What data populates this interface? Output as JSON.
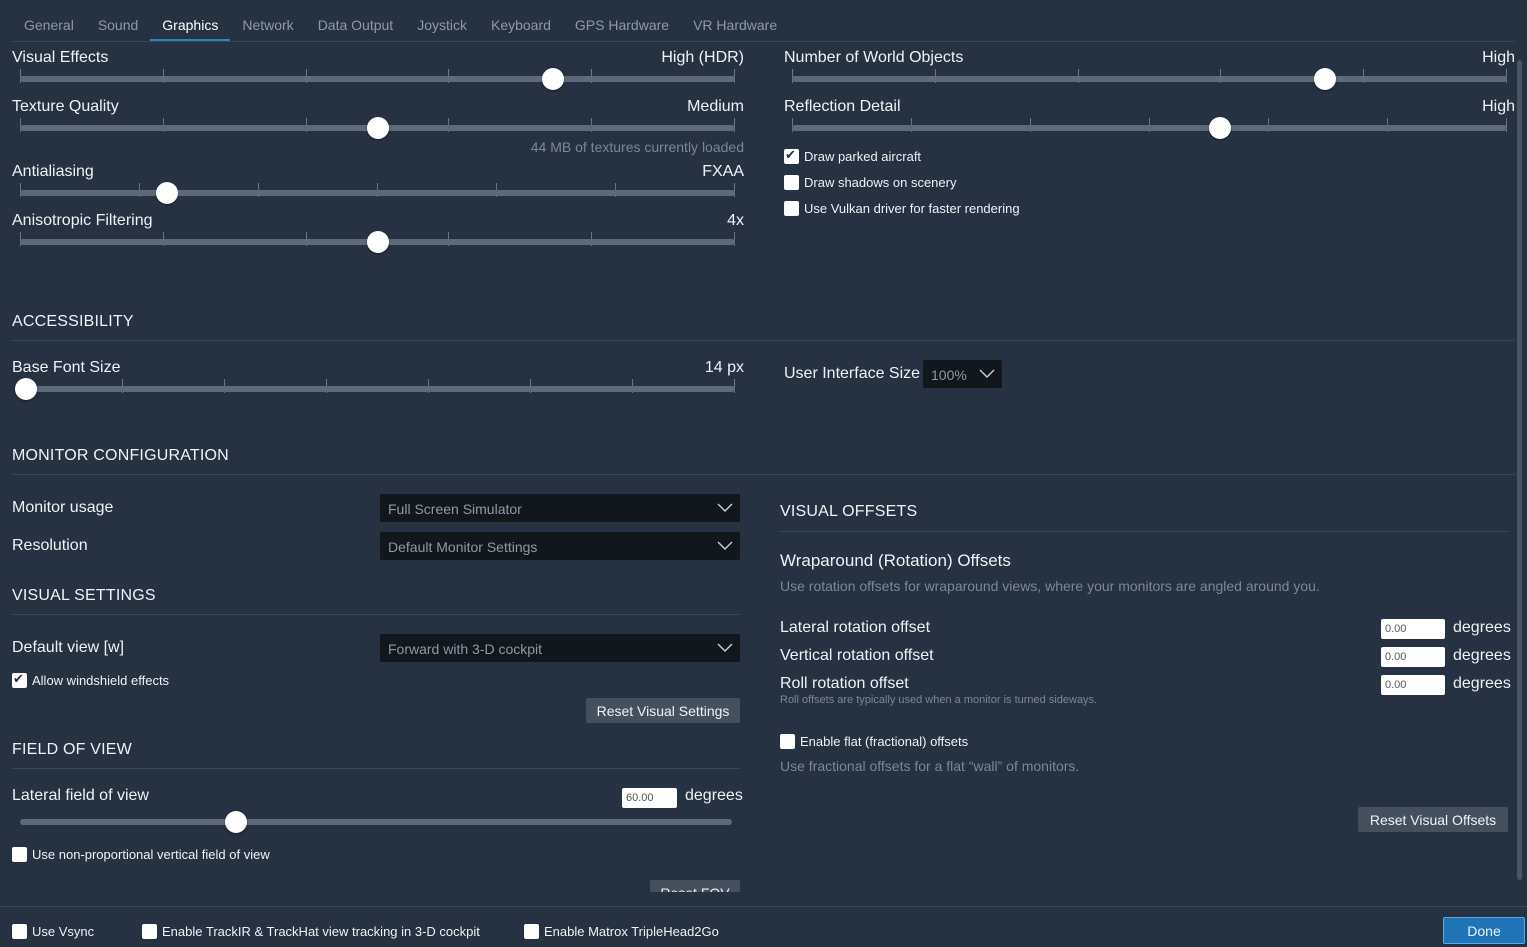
{
  "tabs": [
    "General",
    "Sound",
    "Graphics",
    "Network",
    "Data Output",
    "Joystick",
    "Keyboard",
    "GPS Hardware",
    "VR Hardware"
  ],
  "active_tab": "Graphics",
  "graphics": {
    "visual_effects": {
      "label": "Visual Effects",
      "value": "High (HDR)",
      "level": 0.75
    },
    "texture_quality": {
      "label": "Texture Quality",
      "value": "Medium",
      "level": 0.5,
      "note": "44 MB of textures currently loaded"
    },
    "antialiasing": {
      "label": "Antialiasing",
      "value": "FXAA",
      "level": 0.2
    },
    "anisotropic": {
      "label": "Anisotropic Filtering",
      "value": "4x",
      "level": 0.5
    },
    "world_objects": {
      "label": "Number of World Objects",
      "value": "High",
      "level": 0.75
    },
    "reflection": {
      "label": "Reflection Detail",
      "value": "High",
      "level": 0.6
    },
    "draw_parked": {
      "label": "Draw parked aircraft",
      "checked": true
    },
    "draw_shadows": {
      "label": "Draw shadows on scenery",
      "checked": false
    },
    "vulkan": {
      "label": "Use Vulkan driver for faster rendering",
      "checked": false
    }
  },
  "accessibility": {
    "title": "ACCESSIBILITY",
    "base_font": {
      "label": "Base Font Size",
      "value": "14 px",
      "level": 0.0
    },
    "ui_size": {
      "label": "User Interface Size",
      "value": "100%"
    }
  },
  "monitor": {
    "title": "MONITOR CONFIGURATION",
    "usage_label": "Monitor usage",
    "usage_value": "Full Screen Simulator",
    "resolution_label": "Resolution",
    "resolution_value": "Default Monitor Settings"
  },
  "visual_settings": {
    "title": "VISUAL SETTINGS",
    "default_view_label": "Default view [w]",
    "default_view_value": "Forward with 3-D cockpit",
    "windshield": {
      "label": "Allow windshield effects",
      "checked": true
    },
    "reset_label": "Reset Visual Settings"
  },
  "fov": {
    "title": "FIELD OF VIEW",
    "lateral_label": "Lateral field of view",
    "lateral_value": "60.00",
    "unit": "degrees",
    "level": 0.3,
    "nonprop": {
      "label": "Use non-proportional vertical field of view",
      "checked": false
    },
    "reset_label": "Reset FOV"
  },
  "offsets": {
    "title": "VISUAL OFFSETS",
    "wrap_title": "Wraparound (Rotation) Offsets",
    "wrap_desc": "Use rotation offsets for wraparound views, where your monitors are angled around you.",
    "lateral_label": "Lateral rotation offset",
    "vertical_label": "Vertical rotation offset",
    "roll_label": "Roll rotation offset",
    "lateral_value": "0.00",
    "vertical_value": "0.00",
    "roll_value": "0.00",
    "unit": "degrees",
    "roll_note": "Roll offsets are typically used when a monitor is turned sideways.",
    "flat": {
      "label": "Enable flat (fractional) offsets",
      "checked": false
    },
    "flat_desc": "Use fractional offsets for a flat “wall” of monitors.",
    "reset_label": "Reset Visual Offsets"
  },
  "bottom": {
    "vsync": {
      "label": "Use Vsync",
      "checked": false
    },
    "trackir": {
      "label": "Enable TrackIR & TrackHat view tracking in 3-D cockpit",
      "checked": false
    },
    "matrox": {
      "label": "Enable Matrox TripleHead2Go",
      "checked": false
    },
    "done_label": "Done"
  },
  "colors": {
    "background": "#263141",
    "accent": "#2a82c7",
    "primary_button": "#1f74b8"
  }
}
